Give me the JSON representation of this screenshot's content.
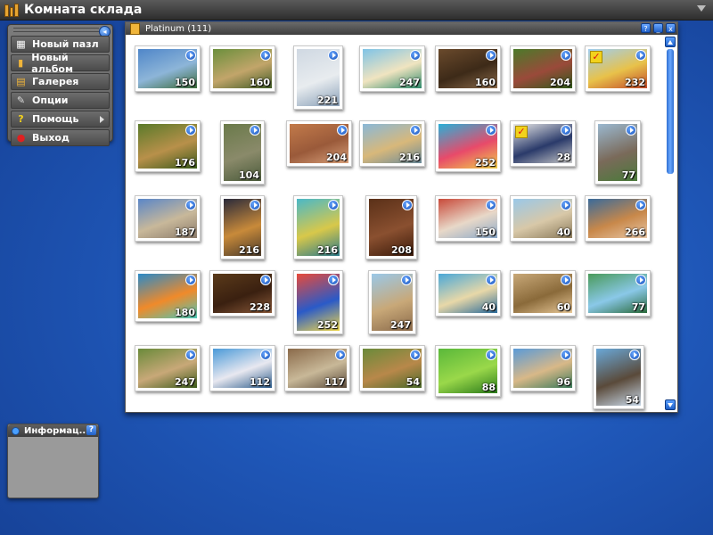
{
  "app": {
    "title": "Комната склада"
  },
  "menu": {
    "items": [
      {
        "label": "Новый пазл",
        "icon": "puzzle-icon",
        "glyph": "▦",
        "color": "#ffffff"
      },
      {
        "label": "Новый альбом",
        "icon": "album-icon",
        "glyph": "▮",
        "color": "#f0b53a"
      },
      {
        "label": "Галерея",
        "icon": "gallery-icon",
        "glyph": "▤",
        "color": "#f0b53a"
      },
      {
        "label": "Опции",
        "icon": "wrench-icon",
        "glyph": "✎",
        "color": "#dddddd"
      },
      {
        "label": "Помощь",
        "icon": "help-icon",
        "glyph": "?",
        "color": "#f5d21c"
      },
      {
        "label": "Выход",
        "icon": "exit-icon",
        "glyph": "●",
        "color": "#e02020"
      }
    ]
  },
  "info": {
    "title": "Информац...",
    "help": "?"
  },
  "album": {
    "title": "Platinum (111)",
    "buttons": [
      "?",
      "_",
      "x"
    ]
  },
  "thumbnails": [
    {
      "count": "150",
      "colors": [
        "#4f86c9",
        "#8db5d8",
        "#3b6b3a"
      ],
      "checked": false
    },
    {
      "count": "160",
      "colors": [
        "#6b8f3c",
        "#c2a56a",
        "#3f5b25"
      ],
      "checked": false
    },
    {
      "count": "221",
      "colors": [
        "#cfd8e2",
        "#e8ecef",
        "#8aa0b8"
      ],
      "checked": false
    },
    {
      "count": "247",
      "colors": [
        "#7fc3e6",
        "#f0e4c0",
        "#2f8a6b"
      ],
      "checked": false
    },
    {
      "count": "160",
      "colors": [
        "#6a4a2c",
        "#3d2a18",
        "#8a6a4a"
      ],
      "checked": false
    },
    {
      "count": "204",
      "colors": [
        "#4b7a2a",
        "#9a4a3a",
        "#2f5a1a"
      ],
      "checked": false
    },
    {
      "count": "232",
      "colors": [
        "#9fcdf0",
        "#e8c24a",
        "#c24a2a"
      ],
      "checked": true
    },
    {
      "count": "176",
      "colors": [
        "#5a7a2a",
        "#b8904a",
        "#3a5a1a"
      ],
      "checked": false
    },
    {
      "count": "104",
      "colors": [
        "#6a7a4a",
        "#8a8a6a",
        "#4a5a3a"
      ],
      "checked": false
    },
    {
      "count": "204",
      "colors": [
        "#c27a4a",
        "#9a5a3a",
        "#d8a07a"
      ],
      "checked": false
    },
    {
      "count": "216",
      "colors": [
        "#8ab8d8",
        "#d8b87a",
        "#6a8a9a"
      ],
      "checked": false
    },
    {
      "count": "252",
      "colors": [
        "#2ab0d8",
        "#e84a6a",
        "#f0d04a"
      ],
      "checked": false
    },
    {
      "count": "28",
      "colors": [
        "#e8e8e8",
        "#2a3a6a",
        "#c8c8c8"
      ],
      "checked": true
    },
    {
      "count": "77",
      "colors": [
        "#9ab8d0",
        "#7a6a5a",
        "#4a7a3a"
      ],
      "checked": false
    },
    {
      "count": "187",
      "colors": [
        "#5a86c8",
        "#c8b89a",
        "#8a7a6a"
      ],
      "checked": false
    },
    {
      "count": "216",
      "colors": [
        "#2a2a3a",
        "#c88a3a",
        "#4a3a2a"
      ],
      "checked": false
    },
    {
      "count": "216",
      "colors": [
        "#4ab8c8",
        "#d8c84a",
        "#2a7a8a"
      ],
      "checked": false
    },
    {
      "count": "208",
      "colors": [
        "#5a3018",
        "#8a5030",
        "#3a1a0a"
      ],
      "checked": false
    },
    {
      "count": "150",
      "colors": [
        "#c84a3a",
        "#e8d8c8",
        "#8aa8c8"
      ],
      "checked": false
    },
    {
      "count": "40",
      "colors": [
        "#9ac8e8",
        "#d8c8a8",
        "#8a7a5a"
      ],
      "checked": false
    },
    {
      "count": "266",
      "colors": [
        "#3a6a9a",
        "#c8884a",
        "#e8c8a8"
      ],
      "checked": false
    },
    {
      "count": "180",
      "colors": [
        "#2a8ac8",
        "#f08a2a",
        "#4ac8b8"
      ],
      "checked": false
    },
    {
      "count": "228",
      "colors": [
        "#5a3a1a",
        "#3a2010",
        "#8a5a3a"
      ],
      "checked": false
    },
    {
      "count": "252",
      "colors": [
        "#e84a3a",
        "#2a5ac8",
        "#f0d84a"
      ],
      "checked": false
    },
    {
      "count": "247",
      "colors": [
        "#9ac8e8",
        "#c8a878",
        "#8a6a4a"
      ],
      "checked": false
    },
    {
      "count": "40",
      "colors": [
        "#4aa8d8",
        "#e8d8a8",
        "#2a6a9a"
      ],
      "checked": false
    },
    {
      "count": "60",
      "colors": [
        "#c8a878",
        "#8a6a3a",
        "#e8c898"
      ],
      "checked": false
    },
    {
      "count": "77",
      "colors": [
        "#4a9a5a",
        "#8ac8e8",
        "#2a6a3a"
      ],
      "checked": false
    },
    {
      "count": "247",
      "colors": [
        "#6a8a3a",
        "#c8a878",
        "#3a5a1a"
      ],
      "checked": false
    },
    {
      "count": "112",
      "colors": [
        "#4a9ad8",
        "#e8e8f0",
        "#2a5a8a"
      ],
      "checked": false
    },
    {
      "count": "117",
      "colors": [
        "#8a6a4a",
        "#c8b898",
        "#5a4a3a"
      ],
      "checked": false
    },
    {
      "count": "54",
      "colors": [
        "#6a8a3a",
        "#b8884a",
        "#4a6a2a"
      ],
      "checked": false
    },
    {
      "count": "88",
      "colors": [
        "#5ab83a",
        "#9ad84a",
        "#2a7a1a"
      ],
      "checked": false
    },
    {
      "count": "96",
      "colors": [
        "#5a9ad8",
        "#d8b888",
        "#3a7a5a"
      ],
      "checked": false
    },
    {
      "count": "54",
      "colors": [
        "#6aa8d8",
        "#5a4a3a",
        "#c8d8e8"
      ],
      "checked": false
    }
  ]
}
